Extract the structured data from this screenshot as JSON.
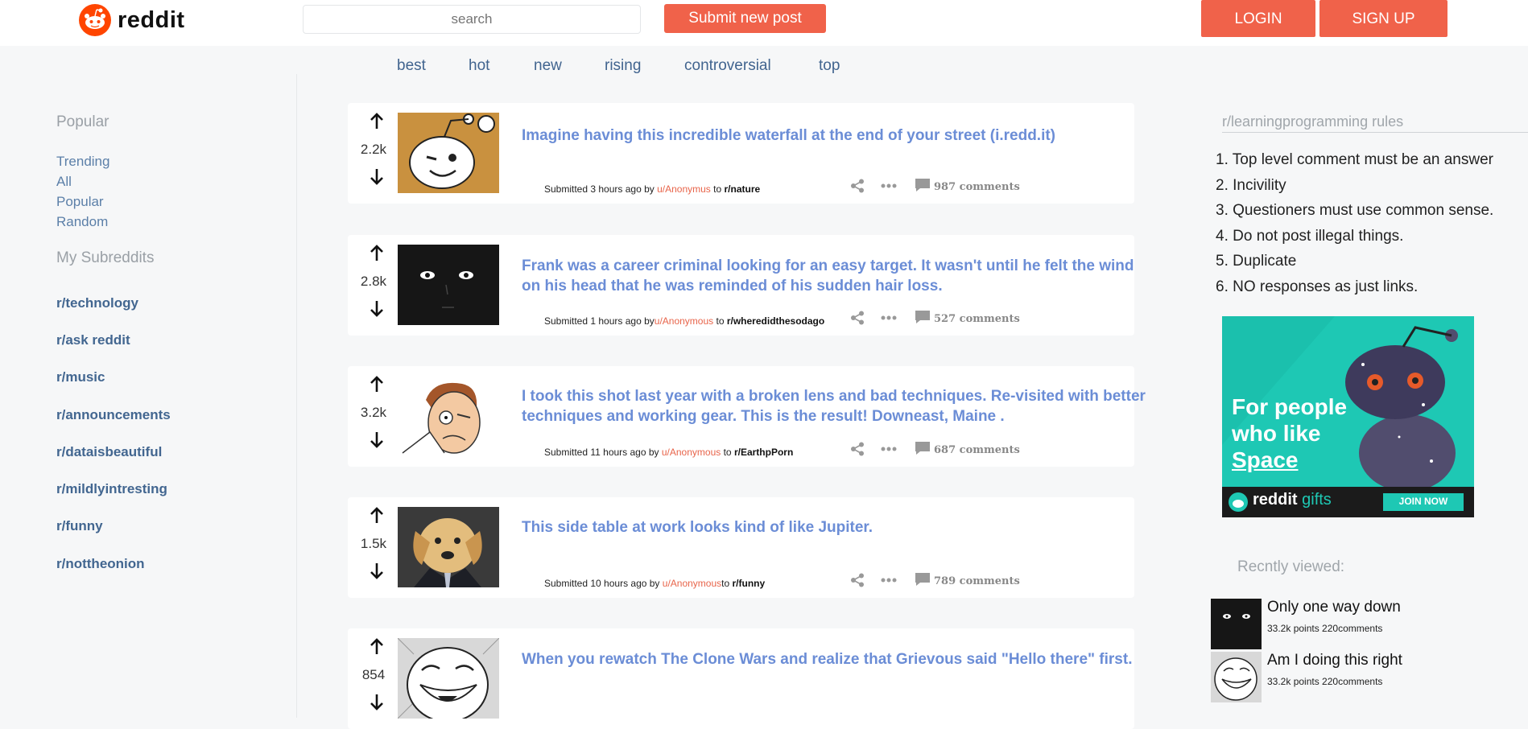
{
  "header": {
    "brand": "reddit",
    "search_placeholder": "search",
    "submit_label": "Submit new post",
    "login_label": "LOGIN",
    "signup_label": "SIGN UP",
    "accent_color": "#f0624a"
  },
  "left_sidebar": {
    "popular_heading": "Popular",
    "popular_links": [
      "Trending",
      "All",
      "Popular",
      "Random"
    ],
    "subreddits_heading": "My Subreddits",
    "subreddits": [
      "r/technology",
      "r/ask reddit",
      "r/music",
      "r/announcements",
      "r/dataisbeautiful",
      "r/mildlyintresting",
      "r/funny",
      "r/nottheonion"
    ]
  },
  "sort_tabs": [
    "best",
    "hot",
    "new",
    "rising",
    "controversial",
    "top"
  ],
  "posts": [
    {
      "score": "2.2k",
      "title": "Imagine having this incredible waterfall at the end of your street (i.redd.it)",
      "meta_prefix": "Submitted 3 hours ago by ",
      "user": "u/Anonymus",
      "meta_mid": " to ",
      "sub": "r/nature",
      "comments": "987 comments",
      "thumb_icon": "snoo-wink-thumbnail"
    },
    {
      "score": "2.8k",
      "title": "Frank was a career criminal looking for an easy target. It wasn't until he felt the wind on his head that he was reminded of his sudden hair loss.",
      "meta_prefix": "Submitted 1 hours ago by",
      "user": "u/Anonymous",
      "meta_mid": " to ",
      "sub": "r/wheredidthesodago",
      "comments": "527 comments",
      "thumb_icon": "dark-face-thumbnail"
    },
    {
      "score": "3.2k",
      "title": "I took this shot last year with a broken lens and bad techniques. Re-visited with better techniques and working gear. This is the result! Downeast, Maine .",
      "meta_prefix": "Submitted 11 hours ago by ",
      "user": "u/Anonymous",
      "meta_mid": " to ",
      "sub": "r/EarthpPorn",
      "comments": "687 comments",
      "thumb_icon": "rage-face-thumbnail"
    },
    {
      "score": "1.5k",
      "title": "This side table at work looks kind of like Jupiter.",
      "meta_prefix": "Submitted 10 hours ago by ",
      "user": "u/Anonymous",
      "meta_mid": "to ",
      "sub": "r/funny",
      "comments": "789 comments",
      "thumb_icon": "dog-in-suit-thumbnail"
    },
    {
      "score": "854",
      "title": "When you rewatch The Clone Wars and realize that Grievous said \"Hello there\" first.",
      "thumb_icon": "trollface-thumbnail"
    }
  ],
  "right_sidebar": {
    "rules_title": "r/learningprogramming rules",
    "rules": [
      "1. Top level comment must be an answer",
      "2. Incivility",
      "3. Questioners must use common sense.",
      "4. Do not post illegal things.",
      "5. Duplicate",
      "6. NO responses as just links."
    ],
    "ad": {
      "line1": "For people",
      "line2": "who like",
      "line3": "Space",
      "brand": "reddit",
      "brand_suffix": "gifts",
      "cta": "JOIN NOW",
      "bg_color": "#1ec8b4"
    },
    "recent_title": "Recntly viewed:",
    "recent": [
      {
        "title": "Only one way down",
        "meta": "33.2k points 220comments"
      },
      {
        "title": "Am I doing this right",
        "meta": "33.2k points 220comments"
      }
    ]
  }
}
